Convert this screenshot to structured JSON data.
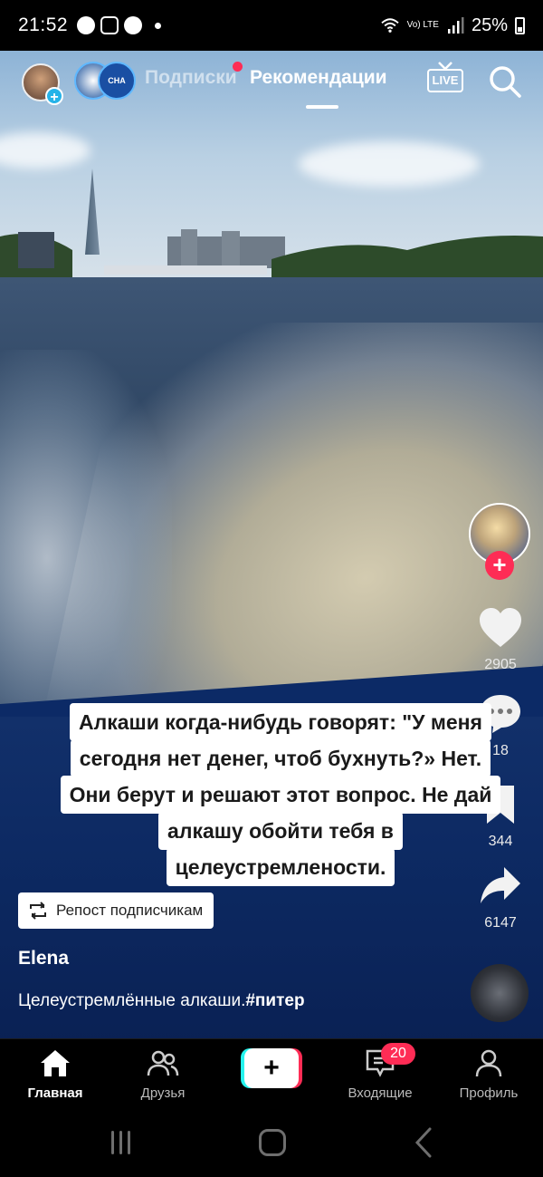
{
  "status_bar": {
    "time": "21:52",
    "network": "Vo) LTE",
    "battery": "25%"
  },
  "top_tabs": {
    "following": "Подписки",
    "for_you": "Рекомендации",
    "live_label": "LIVE",
    "live_avatar_label": "CHA"
  },
  "actions": {
    "likes": "2905",
    "comments": "18",
    "saves": "344",
    "shares": "6147"
  },
  "caption_lines": [
    "Алкаши когда-нибудь говорят: \"У меня",
    "сегодня нет денег, чтоб бухнуть?» Нет.",
    "Они берут и решают этот вопрос. Не дай",
    "алкашу обойти тебя в",
    "целеустремлености."
  ],
  "repost_label": "Репост подписчикам",
  "author": "Elena",
  "description_text": "Целеустремлённые алкаши.",
  "description_tag": "#питер",
  "bottom_nav": {
    "home": "Главная",
    "friends": "Друзья",
    "create": "+",
    "inbox": "Входящие",
    "inbox_badge": "20",
    "profile": "Профиль"
  },
  "colors": {
    "accent_red": "#fe2c55",
    "accent_cyan": "#25f4ee",
    "follow_plus_blue": "#26b3e8"
  }
}
